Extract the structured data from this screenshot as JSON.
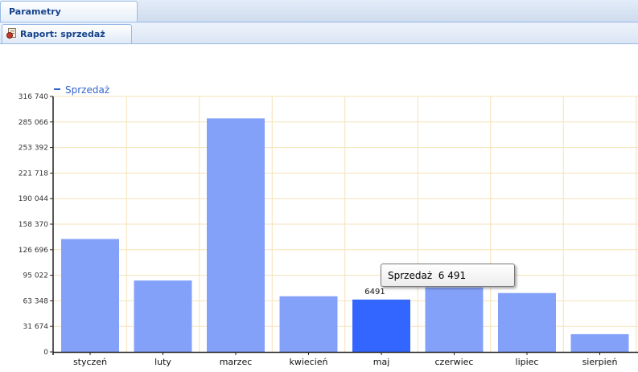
{
  "tabs": {
    "main_tab_label": "Parametry",
    "report_tab_label": "Raport: sprzedaż"
  },
  "chart_data": {
    "type": "bar",
    "legend": "Sprzedaż",
    "legend_position": "top-left",
    "categories": [
      "styczeń",
      "luty",
      "marzec",
      "kwiecień",
      "maj",
      "czerwiec",
      "lipiec",
      "sierpień"
    ],
    "series": [
      {
        "name": "Sprzedaż",
        "values": [
          140000,
          88500,
          289500,
          69000,
          64910,
          80000,
          73000,
          22000
        ]
      }
    ],
    "ylim": [
      0,
      316740
    ],
    "yticks": [
      0,
      31674,
      63348,
      95022,
      126696,
      158370,
      190044,
      221718,
      253392,
      285066,
      316740
    ],
    "ytick_labels": [
      "0",
      "31 674",
      "63 348",
      "95 022",
      "126 696",
      "158 370",
      "190 044",
      "221 718",
      "253 392",
      "285 066",
      "316 740"
    ],
    "grid": true,
    "highlighted_index": 4,
    "data_label": "6491",
    "colors": {
      "bar": "#84a1fa",
      "bar_highlight": "#3366ff",
      "grid": "#f5e2b8",
      "axis": "#222222",
      "legend": "#3366cc"
    }
  },
  "tooltip": {
    "series_name": "Sprzedaż",
    "value": "6 491"
  }
}
